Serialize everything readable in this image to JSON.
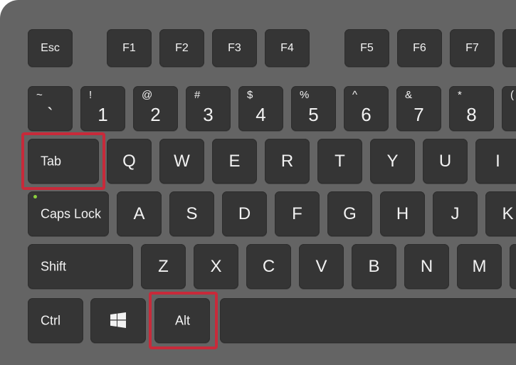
{
  "keyboard": {
    "function_row": {
      "esc": "Esc",
      "f1": "F1",
      "f2": "F2",
      "f3": "F3",
      "f4": "F4",
      "f5": "F5",
      "f6": "F6",
      "f7": "F7"
    },
    "number_row": [
      {
        "shift": "~",
        "base": "`"
      },
      {
        "shift": "!",
        "base": "1"
      },
      {
        "shift": "@",
        "base": "2"
      },
      {
        "shift": "#",
        "base": "3"
      },
      {
        "shift": "$",
        "base": "4"
      },
      {
        "shift": "%",
        "base": "5"
      },
      {
        "shift": "^",
        "base": "6"
      },
      {
        "shift": "&",
        "base": "7"
      },
      {
        "shift": "*",
        "base": "8"
      },
      {
        "shift": "(",
        "base": ""
      }
    ],
    "tab_row": {
      "tab": "Tab",
      "letters": [
        "Q",
        "W",
        "E",
        "R",
        "T",
        "Y",
        "U",
        "I"
      ]
    },
    "home_row": {
      "caps": "Caps Lock",
      "letters": [
        "A",
        "S",
        "D",
        "F",
        "G",
        "H",
        "J",
        "K"
      ]
    },
    "shift_row": {
      "shift": "Shift",
      "letters": [
        "Z",
        "X",
        "C",
        "V",
        "B",
        "N",
        "M"
      ]
    },
    "bottom_row": {
      "ctrl": "Ctrl",
      "alt": "Alt",
      "windows_icon": "windows-logo-icon"
    },
    "highlighted_keys": [
      "Tab",
      "Alt"
    ],
    "colors": {
      "board": "#646464",
      "key": "#353535",
      "label": "#f2f2f2",
      "highlight": "#c82a3a",
      "caps_led": "#8ccf3e"
    }
  }
}
